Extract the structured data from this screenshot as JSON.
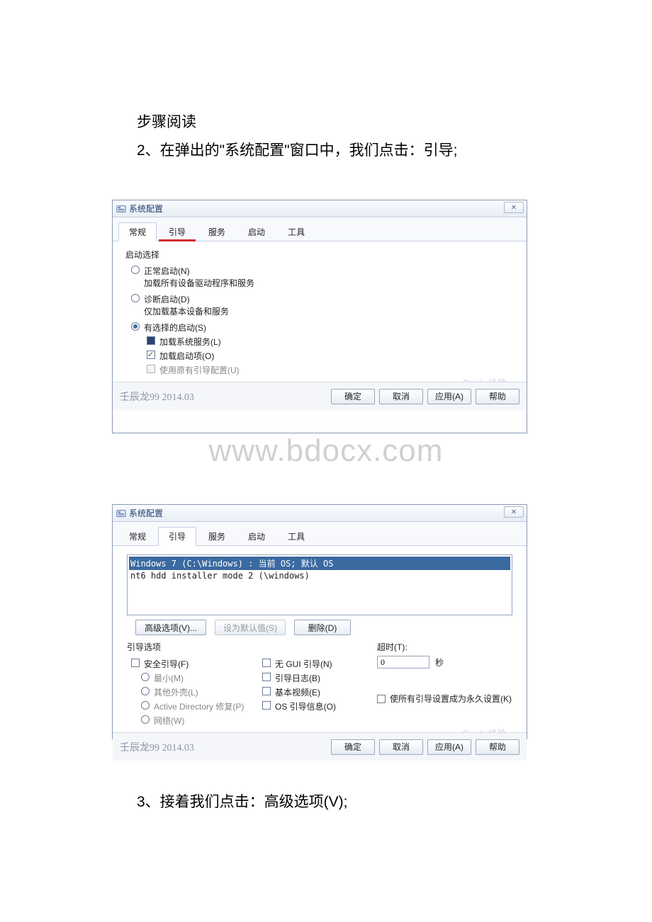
{
  "instructions": {
    "step_read": "步骤阅读",
    "step_two": "2、在弹出的\"系统配置\"窗口中，我们点击：引导;",
    "step_three": "3、接着我们点击：高级选项(V);"
  },
  "watermark_text": "www.bdocx.com",
  "dialog_common": {
    "window_title": "系统配置",
    "close_glyph": "✕",
    "tabs": [
      "常规",
      "引导",
      "服务",
      "启动",
      "工具"
    ],
    "signature": "壬辰龙99 2014.03",
    "baidu_watermark": "Baidu经验",
    "buttons": {
      "ok": "确定",
      "cancel": "取消",
      "apply": "应用(A)",
      "help": "帮助"
    }
  },
  "dialog1": {
    "group_title": "启动选择",
    "opt_normal": "正常启动(N)",
    "opt_normal_desc": "加载所有设备驱动程序和服务",
    "opt_diag": "诊断启动(D)",
    "opt_diag_desc": "仅加载基本设备和服务",
    "opt_sel": "有选择的启动(S)",
    "chk_sys_svc": "加载系统服务(L)",
    "chk_startup": "加载启动项(O)",
    "chk_orig": "使用原有引导配置(U)"
  },
  "dialog2": {
    "list_rows": [
      "Windows 7 (C:\\Windows) : 当前 OS; 默认 OS",
      "nt6 hdd installer mode 2 (\\windows)"
    ],
    "btn_adv": "高级选项(V)...",
    "btn_default": "设为默认值(S)",
    "btn_delete": "删除(D)",
    "grp_boot": "引导选项",
    "chk_safe": "安全引导(F)",
    "rad_min": "最小(M)",
    "rad_shell": "其他外壳(L)",
    "rad_adrepair": "Active Directory 修复(P)",
    "rad_net": "网络(W)",
    "chk_nogui": "无 GUI 引导(N)",
    "chk_bootlog": "引导日志(B)",
    "chk_basevideo": "基本视频(E)",
    "chk_osinfo": "OS 引导信息(O)",
    "timeout_label": "超时(T):",
    "timeout_value": "0",
    "timeout_unit": "秒",
    "perm_label": "使所有引导设置成为永久设置(K)"
  }
}
